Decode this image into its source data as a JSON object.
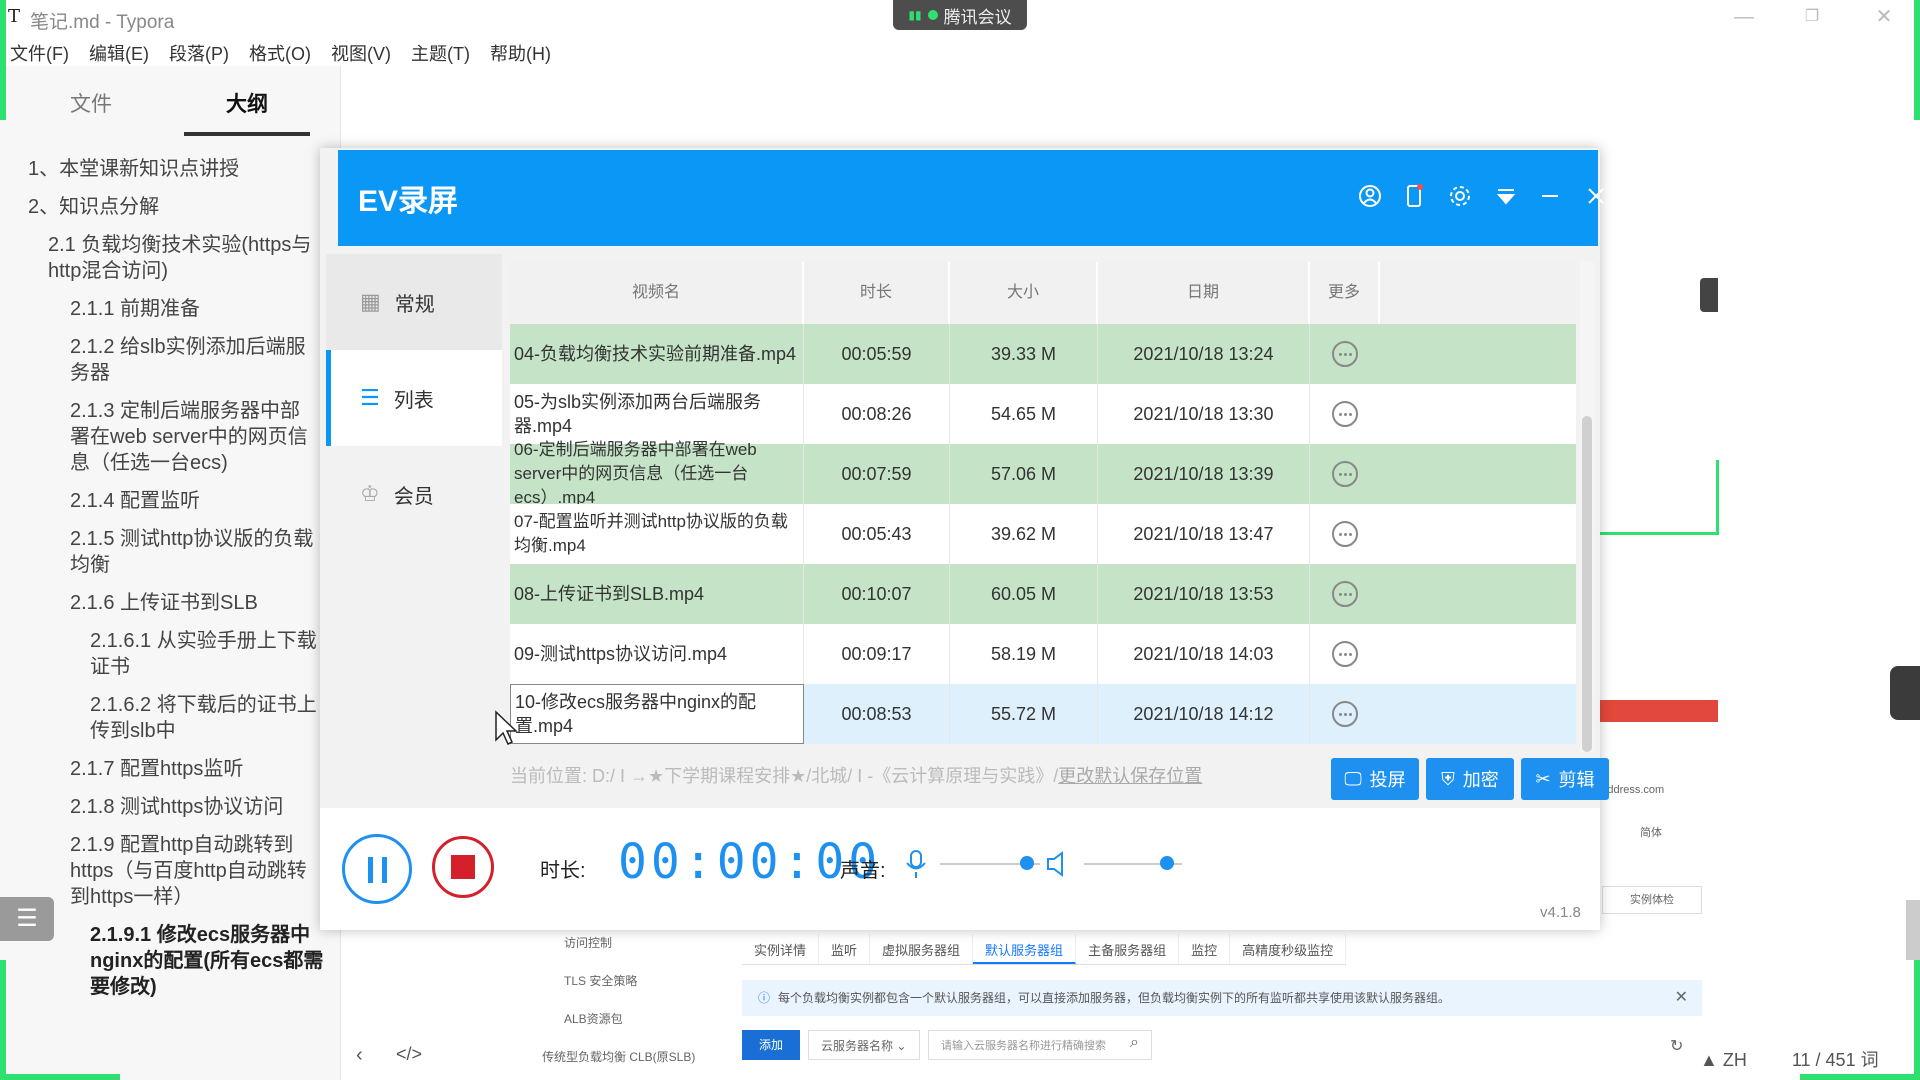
{
  "typora": {
    "app_icon": "T",
    "title": "笔记.md - Typora",
    "menu": [
      "文件(F)",
      "编辑(E)",
      "段落(P)",
      "格式(O)",
      "视图(V)",
      "主题(T)",
      "帮助(H)"
    ],
    "sidebar_tabs": [
      "文件",
      "大纲"
    ],
    "outline": [
      "1、本堂课新知识点讲授",
      "2、知识点分解",
      "2.1 负载均衡技术实验(https与http混合访问)",
      "2.1.1 前期准备",
      "2.1.2 给slb实例添加后端服务器",
      "2.1.3 定制后端服务器中部署在web server中的网页信息（任选一台ecs)",
      "2.1.4 配置监听",
      "2.1.5 测试http协议版的负载均衡",
      "2.1.6 上传证书到SLB",
      "2.1.6.1 从实验手册上下载证书",
      "2.1.6.2 将下载后的证书上传到slb中",
      "2.1.7 配置https监听",
      "2.1.8 测试https协议访问",
      "2.1.9 配置http自动跳转到https（与百度http自动跳转到https一样）",
      "2.1.9.1 修改ecs服务器中nginx的配置(所有ecs都需要修改)"
    ],
    "status": {
      "lang": "ZH",
      "words": "11 / 451 词"
    }
  },
  "meeting": {
    "label": "腾讯会议"
  },
  "background_console": {
    "side_items": [
      "访问控制",
      "TLS 安全策略",
      "ALB资源包",
      "传统型负载均衡 CLB(原SLB)"
    ],
    "tabs": [
      "实例详情",
      "监听",
      "虚拟服务器组",
      "默认服务器组",
      "主备服务器组",
      "监控",
      "高精度秒级监控"
    ],
    "active_tab": "默认服务器组",
    "info": "每个负载均衡实例都包含一个默认服务器组，可以直接添加服务器，但负载均衡实例下的所有监听都共享使用该默认服务器组。",
    "add_button": "添加",
    "select": "云服务器名称",
    "search_placeholder": "请输入云服务器名称进行精确搜索",
    "right_texts": [
      "Address.com",
      "简体",
      "实例体检",
      ")"
    ]
  },
  "ev": {
    "title": "EV录屏",
    "nav": [
      "常规",
      "列表",
      "会员"
    ],
    "columns": [
      "视频名",
      "时长",
      "大小",
      "日期",
      "更多"
    ],
    "rows": [
      {
        "name": "04-负载均衡技术实验前期准备.mp4",
        "duration": "00:05:59",
        "size": "39.33 M",
        "date": "2021/10/18 13:24"
      },
      {
        "name": "05-为slb实例添加两台后端服务器.mp4",
        "duration": "00:08:26",
        "size": "54.65 M",
        "date": "2021/10/18 13:30"
      },
      {
        "name": "06-定制后端服务器中部署在web server中的网页信息（任选一台ecs）.mp4",
        "duration": "00:07:59",
        "size": "57.06 M",
        "date": "2021/10/18 13:39"
      },
      {
        "name": "07-配置监听并测试http协议版的负载均衡.mp4",
        "duration": "00:05:43",
        "size": "39.62 M",
        "date": "2021/10/18 13:47"
      },
      {
        "name": "08-上传证书到SLB.mp4",
        "duration": "00:10:07",
        "size": "60.05 M",
        "date": "2021/10/18 13:53"
      },
      {
        "name": "09-测试https协议访问.mp4",
        "duration": "00:09:17",
        "size": "58.19 M",
        "date": "2021/10/18 14:03"
      },
      {
        "name": "10-修改ecs服务器中nginx的配置.mp4",
        "duration": "00:08:53",
        "size": "55.72 M",
        "date": "2021/10/18 14:12"
      }
    ],
    "path_prefix": "当前位置: D:/ I →★下学期课程安排★/北城/ I -《云计算原理与实践》/",
    "path_link": "更改默认保存位置",
    "actions": [
      "投屏",
      "加密",
      "剪辑"
    ],
    "duration_label": "时长:",
    "timer": "00:00:00",
    "sound_label": "声音:",
    "version": "v4.1.8"
  },
  "colors": {
    "accent": "#0a97f5",
    "row_green": "#c5e4c7",
    "stop_red": "#d4202b",
    "share_border": "#2ee06f"
  }
}
